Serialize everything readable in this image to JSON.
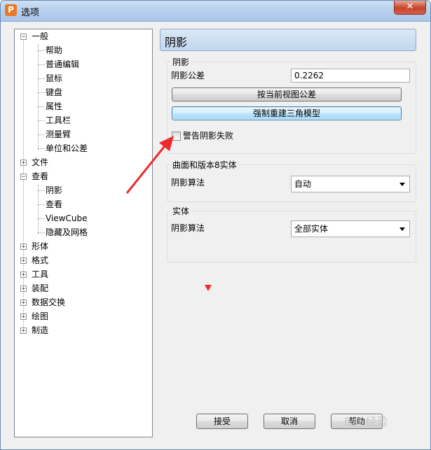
{
  "window": {
    "title": "选项",
    "app_icon_letter": "P",
    "close_glyph": "✕"
  },
  "tree": {
    "items": [
      {
        "label": "一般",
        "expander": "−"
      },
      {
        "label": "帮助"
      },
      {
        "label": "普通编辑"
      },
      {
        "label": "鼠标"
      },
      {
        "label": "键盘"
      },
      {
        "label": "属性"
      },
      {
        "label": "工具栏"
      },
      {
        "label": "测量臂"
      },
      {
        "label": "单位和公差"
      },
      {
        "label": "文件",
        "expander": "+"
      },
      {
        "label": "查看",
        "expander": "−"
      },
      {
        "label": "阴影"
      },
      {
        "label": "查看"
      },
      {
        "label": "ViewCube"
      },
      {
        "label": "隐藏及网格"
      },
      {
        "label": "形体",
        "expander": "+"
      },
      {
        "label": "格式",
        "expander": "+"
      },
      {
        "label": "工具",
        "expander": "+"
      },
      {
        "label": "装配",
        "expander": "+"
      },
      {
        "label": "数据交换",
        "expander": "+"
      },
      {
        "label": "绘图",
        "expander": "+"
      },
      {
        "label": "制造",
        "expander": "+"
      }
    ]
  },
  "panel": {
    "title": "阴影",
    "shading_group": {
      "title": "阴影",
      "tolerance_label": "阴影公差",
      "tolerance_value": "0.2262",
      "current_view_button": "按当前视图公差",
      "rebuild_button": "强制重建三角模型",
      "warn_checkbox_label": "警告阴影失败",
      "warn_checked": false
    },
    "surface_group": {
      "title": "曲面和版本8实体",
      "algorithm_label": "阴影算法",
      "algorithm_value": "自动"
    },
    "solid_group": {
      "title": "实体",
      "algorithm_label": "阴影算法",
      "algorithm_value": "全部实体"
    }
  },
  "footer": {
    "accept_label": "接受",
    "cancel_label": "取消",
    "help_label": "帮助"
  },
  "annotation": {
    "arrow_color": "#ef2a2a"
  },
  "watermark": "Bai 经验"
}
